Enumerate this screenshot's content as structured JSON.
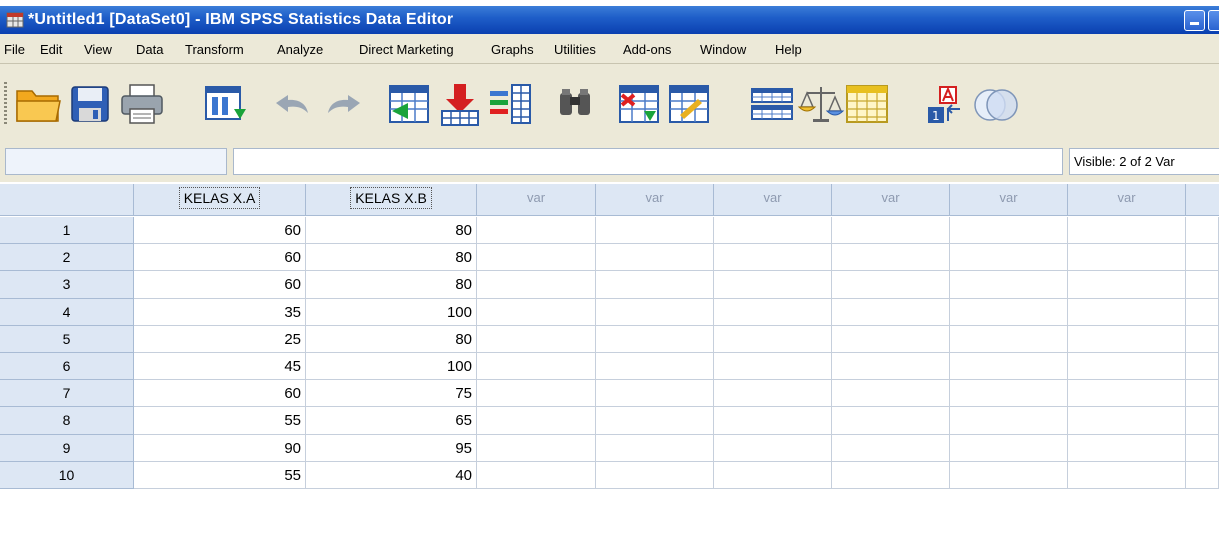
{
  "window": {
    "title": "*Untitled1 [DataSet0] - IBM SPSS Statistics Data Editor"
  },
  "menu": [
    "File",
    "Edit",
    "View",
    "Data",
    "Transform",
    "Analyze",
    "Direct Marketing",
    "Graphs",
    "Utilities",
    "Add-ons",
    "Window",
    "Help"
  ],
  "toolbar": {
    "icons": [
      "open-folder-icon",
      "save-icon",
      "print-icon",
      "dialog-recall-icon",
      "undo-icon",
      "redo-icon",
      "goto-case-icon",
      "goto-variable-icon",
      "variables-icon",
      "find-icon",
      "insert-cases-icon",
      "insert-variable-icon",
      "split-file-icon",
      "weight-cases-icon",
      "select-cases-icon",
      "value-labels-icon",
      "use-sets-icon"
    ]
  },
  "editor": {
    "cell_name": "",
    "cell_value": "",
    "visible": "Visible: 2 of 2 Var"
  },
  "grid": {
    "columns": [
      "KELAS X.A",
      "KELAS X.B",
      "var",
      "var",
      "var",
      "var",
      "var",
      "var"
    ],
    "rows": [
      {
        "n": "1",
        "a": "60",
        "b": "80"
      },
      {
        "n": "2",
        "a": "60",
        "b": "80"
      },
      {
        "n": "3",
        "a": "60",
        "b": "80"
      },
      {
        "n": "4",
        "a": "35",
        "b": "100"
      },
      {
        "n": "5",
        "a": "25",
        "b": "80"
      },
      {
        "n": "6",
        "a": "45",
        "b": "100"
      },
      {
        "n": "7",
        "a": "60",
        "b": "75"
      },
      {
        "n": "8",
        "a": "55",
        "b": "65"
      },
      {
        "n": "9",
        "a": "90",
        "b": "95"
      },
      {
        "n": "10",
        "a": "55",
        "b": "40"
      }
    ]
  },
  "colors": {
    "titlebar": "#0a3fb0",
    "chrome": "#ece9d8",
    "header_cell": "#dde7f4",
    "grid_line": "#c6cfdc"
  }
}
